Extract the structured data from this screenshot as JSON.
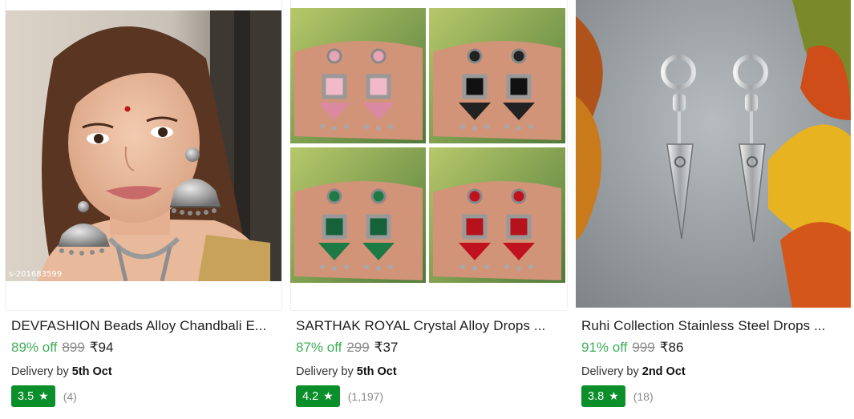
{
  "products": [
    {
      "title": "DEVFASHION Beads Alloy Chandbali E...",
      "discount": "89% off",
      "mrp": "899",
      "price": "₹94",
      "delivery_prefix": "Delivery by",
      "delivery_date": "5th Oct",
      "rating": "3.5",
      "rating_count": "(4)",
      "watermark": "s-201683599"
    },
    {
      "title": "SARTHAK ROYAL Crystal Alloy Drops ...",
      "discount": "87% off",
      "mrp": "299",
      "price": "₹37",
      "delivery_prefix": "Delivery by",
      "delivery_date": "5th Oct",
      "rating": "4.2",
      "rating_count": "(1,197)"
    },
    {
      "title": "Ruhi Collection Stainless Steel Drops ...",
      "discount": "91% off",
      "mrp": "999",
      "price": "₹86",
      "delivery_prefix": "Delivery by",
      "delivery_date": "2nd Oct",
      "rating": "3.8",
      "rating_count": "(18)"
    }
  ],
  "colors": {
    "discount_green": "#3fae5a",
    "rating_badge": "#0b8f2a"
  },
  "icons": {
    "rating_star": "star-icon"
  }
}
